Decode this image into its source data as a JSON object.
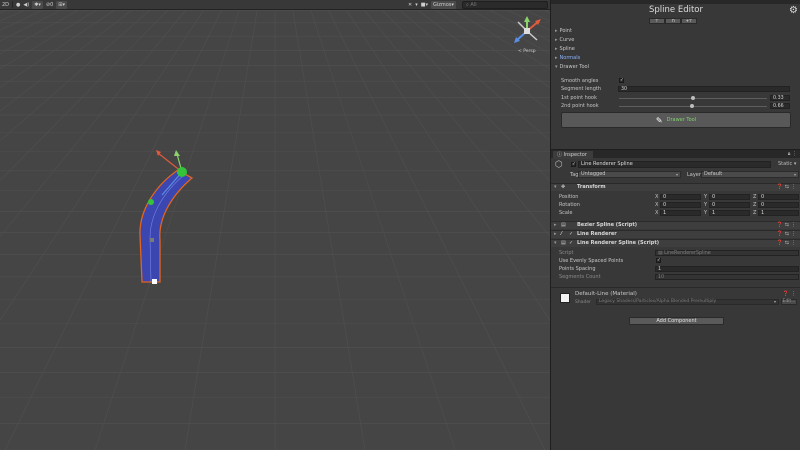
{
  "scene": {
    "toolbar": {
      "view_2d": "2D",
      "fx_count": "0",
      "gizmos": "Gizmos",
      "search_placeholder": "All"
    },
    "persp_label": "< Persp"
  },
  "spline_editor": {
    "title": "Spline Editor",
    "icon_buttons": [
      "⊤",
      "⊓",
      "+⊤"
    ],
    "sections": {
      "point": "Point",
      "curve": "Curve",
      "spline": "Spline",
      "normals": "Normals",
      "drawer_tool": "Drawer Tool"
    },
    "drawer": {
      "smooth_angles_label": "Smooth angles",
      "smooth_angles_checked": true,
      "segment_length_label": "Segment length",
      "segment_length_value": "30",
      "hook1_label": "1st point hook",
      "hook1_value": "0.33",
      "hook2_label": "2nd point hook",
      "hook2_value": "0.66",
      "button_label": "Drawer Tool"
    }
  },
  "inspector": {
    "tab_label": "Inspector",
    "object_name": "Line Renderer Spline",
    "static_label": "Static",
    "tag_label": "Tag",
    "tag_value": "Untagged",
    "layer_label": "Layer",
    "layer_value": "Default",
    "transform": {
      "title": "Transform",
      "position_label": "Position",
      "rotation_label": "Rotation",
      "scale_label": "Scale",
      "position": [
        "0",
        "0",
        "0"
      ],
      "rotation": [
        "0",
        "0",
        "0"
      ],
      "scale": [
        "1",
        "1",
        "1"
      ]
    },
    "components": {
      "bezier": "Bezier Spline (Script)",
      "line_renderer": "Line Renderer",
      "lrs": "Line Renderer Spline (Script)"
    },
    "lrs_props": {
      "script_label": "Script",
      "script_value": "LineRendererSpline",
      "use_even_label": "Use Evenly Spaced Points",
      "use_even_checked": true,
      "spacing_label": "Points Spacing",
      "spacing_value": "1",
      "segments_label": "Segments Count",
      "segments_value": "10"
    },
    "material": {
      "name": "Default-Line (Material)",
      "shader_label": "Shader",
      "shader_value": "Legacy Shaders/Particles/Alpha Blended Premultiply",
      "edit_label": "Edit..."
    },
    "add_component": "Add Component"
  }
}
